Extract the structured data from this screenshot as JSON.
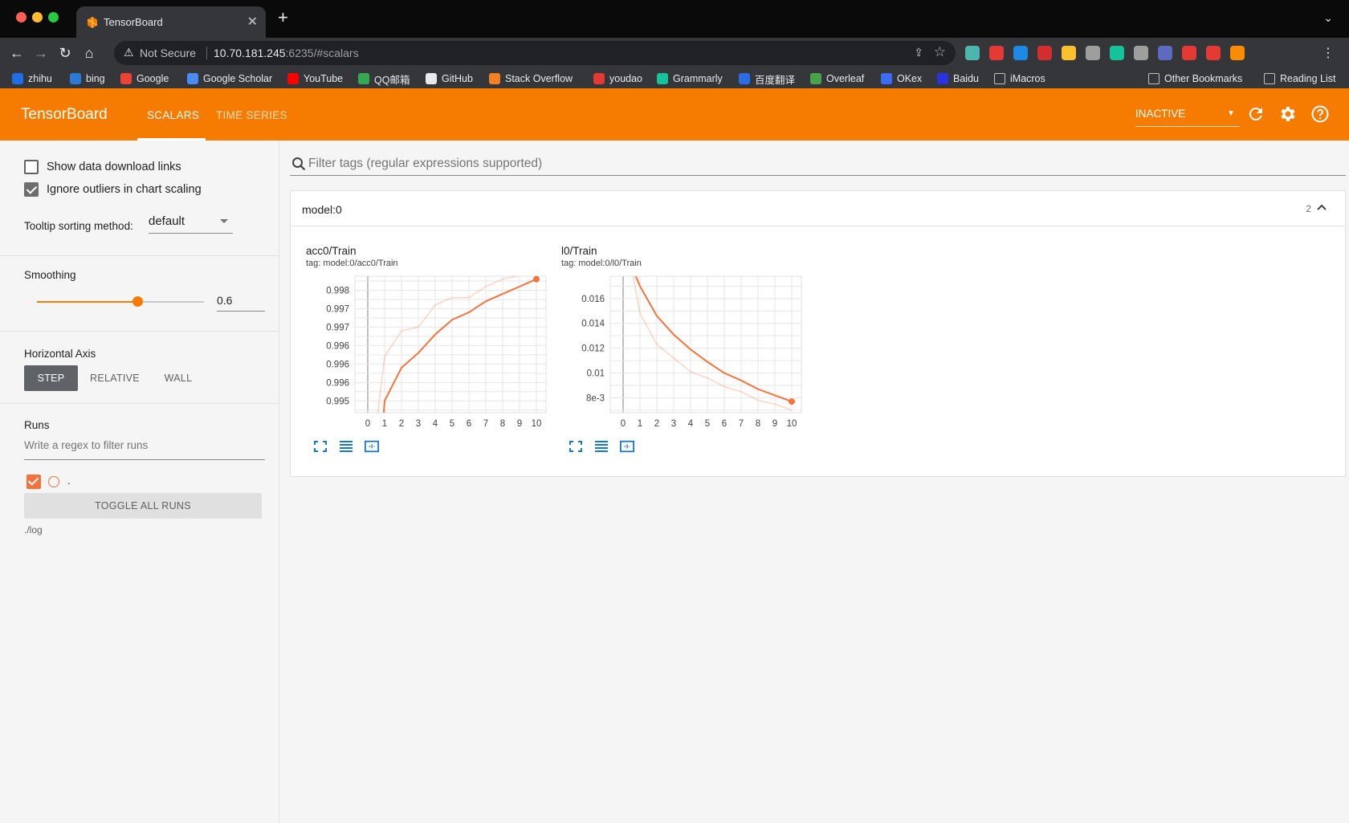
{
  "browser": {
    "tab_title": "TensorBoard",
    "address": {
      "security": "Not Secure",
      "host": "10.70.181.245",
      "rest": ":6235/#scalars"
    },
    "extensions": [
      {
        "name": "ext-1",
        "color": "#4db6ac"
      },
      {
        "name": "ext-2",
        "color": "#e53935"
      },
      {
        "name": "ext-3",
        "color": "#1e88e5"
      },
      {
        "name": "ext-4",
        "color": "#d32f2f"
      },
      {
        "name": "ext-5",
        "color": "#fbc02d"
      },
      {
        "name": "ext-6",
        "color": "#9e9e9e"
      },
      {
        "name": "ext-7",
        "color": "#15c39a"
      },
      {
        "name": "ext-8",
        "color": "#9e9e9e"
      },
      {
        "name": "ext-9",
        "color": "#5c6bc0"
      },
      {
        "name": "ext-10",
        "color": "#e53935"
      },
      {
        "name": "ext-11",
        "color": "#e53935"
      },
      {
        "name": "ext-12",
        "color": "#fb8c00"
      }
    ],
    "bookmarks": [
      "zhihu",
      "bing",
      "Google",
      "Google Scholar",
      "YouTube",
      "QQ邮箱",
      "GitHub",
      "Stack Overflow",
      "youdao",
      "Grammarly",
      "百度翻译",
      "Overleaf",
      "OKex",
      "Baidu",
      "iMacros"
    ],
    "bookmark_colors": [
      "#1e6fe6",
      "#2b7bd6",
      "#ea4335",
      "#4a8af4",
      "#ff0000",
      "#34a853",
      "#e8eaed",
      "#f48024",
      "#e53935",
      "#15c39a",
      "#2d6be4",
      "#47a248",
      "#3b6cf6",
      "#2932e1",
      "#bdc1c6"
    ],
    "other_bookmarks": "Other Bookmarks",
    "reading_list": "Reading List"
  },
  "header": {
    "brand": "TensorBoard",
    "tabs": [
      "SCALARS",
      "TIME SERIES"
    ],
    "status": "INACTIVE",
    "accent": "#f57c00"
  },
  "sidebar": {
    "show_download": "Show data download links",
    "ignore_outliers": "Ignore outliers in chart scaling",
    "tooltip_label": "Tooltip sorting method:",
    "tooltip_value": "default",
    "smoothing_label": "Smoothing",
    "smoothing_value": "0.6",
    "smoothing_fraction": 0.6,
    "axis_label": "Horizontal Axis",
    "axis_options": [
      "STEP",
      "RELATIVE",
      "WALL"
    ],
    "runs_label": "Runs",
    "runs_placeholder": "Write a regex to filter runs",
    "run_name": ".",
    "run_color": "#f4733c",
    "toggle_all": "TOGGLE ALL RUNS",
    "logdir": "./log"
  },
  "main": {
    "filter_placeholder": "Filter tags (regular expressions supported)",
    "group_title": "model:0",
    "group_count": "2"
  },
  "chart_data": [
    {
      "type": "line",
      "title": "acc0/Train",
      "tag": "tag: model:0/acc0/Train",
      "x": [
        0,
        1,
        2,
        3,
        4,
        5,
        6,
        7,
        8,
        9,
        10
      ],
      "xticks": [
        "0",
        "1",
        "2",
        "3",
        "4",
        "5",
        "6",
        "7",
        "8",
        "9",
        "10"
      ],
      "yticks": [
        "0.995",
        "0.996",
        "0.996",
        "0.996",
        "0.997",
        "0.997",
        "0.998"
      ],
      "ylim": [
        0.99468,
        0.99838
      ],
      "ytick_values": [
        0.995,
        0.9955,
        0.996,
        0.9965,
        0.997,
        0.9975,
        0.998
      ],
      "series": [
        {
          "name": "smoothed",
          "x": [
            0.95,
            1,
            2,
            3,
            4,
            5,
            6,
            7,
            8,
            9,
            10
          ],
          "values": [
            0.99468,
            0.995,
            0.9959,
            0.9963,
            0.9968,
            0.9972,
            0.9974,
            0.9977,
            0.9979,
            0.9981,
            0.9983
          ]
        },
        {
          "name": "raw",
          "x": [
            0.6,
            1,
            2,
            3,
            4,
            5,
            6,
            7,
            8,
            9,
            10
          ],
          "values": [
            0.99468,
            0.9962,
            0.9969,
            0.997,
            0.9976,
            0.9978,
            0.9978,
            0.9981,
            0.9983,
            0.9984,
            0.9985
          ]
        }
      ],
      "color": "#f4733c"
    },
    {
      "type": "line",
      "title": "l0/Train",
      "tag": "tag: model:0/l0/Train",
      "x": [
        0,
        1,
        2,
        3,
        4,
        5,
        6,
        7,
        8,
        9,
        10
      ],
      "xticks": [
        "0",
        "1",
        "2",
        "3",
        "4",
        "5",
        "6",
        "7",
        "8",
        "9",
        "10"
      ],
      "yticks": [
        "8e-3",
        "0.01",
        "0.012",
        "0.014",
        "0.016"
      ],
      "ylim": [
        0.0068,
        0.0178
      ],
      "ytick_values": [
        0.008,
        0.01,
        0.012,
        0.014,
        0.016
      ],
      "series": [
        {
          "name": "smoothed",
          "x": [
            0.75,
            1,
            2,
            3,
            4,
            5,
            6,
            7,
            8,
            9,
            10
          ],
          "values": [
            0.0178,
            0.017,
            0.0146,
            0.0131,
            0.0119,
            0.0109,
            0.01,
            0.0094,
            0.0087,
            0.0082,
            0.0077
          ]
        },
        {
          "name": "raw",
          "x": [
            0.6,
            1,
            2,
            3,
            4,
            5,
            6,
            7,
            8,
            9,
            10
          ],
          "values": [
            0.0178,
            0.0148,
            0.0123,
            0.0112,
            0.0101,
            0.0096,
            0.0089,
            0.0085,
            0.0078,
            0.0075,
            0.007
          ]
        }
      ],
      "color": "#f4733c"
    }
  ]
}
